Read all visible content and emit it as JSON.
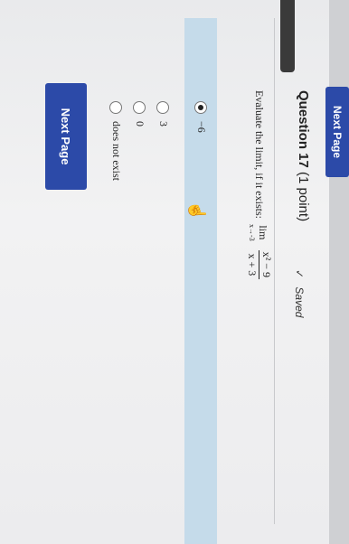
{
  "header": {
    "next_page_label": "Next Page"
  },
  "question": {
    "title": "Question 17",
    "points": "(1 point)",
    "saved_label": "Saved",
    "saved_icon": "check-icon",
    "prompt": "Evaluate the limit, if it exists:",
    "lim_word": "lim",
    "lim_sub": "x→-3",
    "numerator": "x² − 9",
    "denominator": "x + 3"
  },
  "choices": [
    {
      "label": "−6",
      "selected": true
    },
    {
      "label": "3",
      "selected": false
    },
    {
      "label": "0",
      "selected": false
    },
    {
      "label": "does not exist",
      "selected": false
    }
  ],
  "footer": {
    "next_page_label": "Next Page"
  },
  "colors": {
    "accent": "#2c4aa8",
    "selected_bg": "#c5dbea"
  }
}
